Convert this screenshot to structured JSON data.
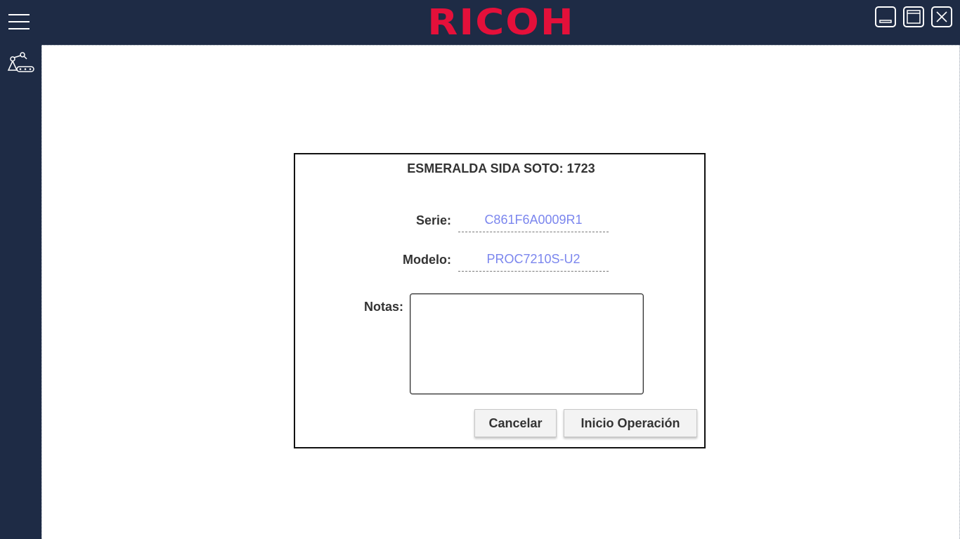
{
  "app": {
    "brand": "RICOH",
    "menu_icon": "hamburger-menu-icon",
    "window_controls": [
      "minimize-icon",
      "maximize-icon",
      "close-icon"
    ],
    "accent_color": "#e4103a",
    "chrome_color": "#1e2b45"
  },
  "sidebar": {
    "items": [
      {
        "icon": "conveyor-robot-icon"
      }
    ]
  },
  "dialog": {
    "title": "ESMERALDA SIDA SOTO: 1723",
    "serie_label": "Serie:",
    "serie_value": "C861F6A0009R1",
    "modelo_label": "Modelo:",
    "modelo_value": "PROC7210S-U2",
    "notas_label": "Notas:",
    "notas_value": "",
    "cancel_label": "Cancelar",
    "start_label": "Inicio Operación",
    "value_color": "#7b86ee"
  }
}
